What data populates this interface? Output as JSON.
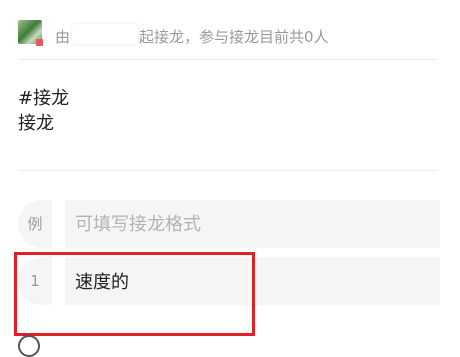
{
  "header": {
    "prefix": "由",
    "suffix": "起接龙，参与接龙目前共0人"
  },
  "post": {
    "title_line1": "#接龙",
    "title_line2": "接龙"
  },
  "example_row": {
    "index_label": "例",
    "placeholder": "可填写接龙格式"
  },
  "entry_row": {
    "index_label": "1",
    "value": "速度的"
  },
  "colors": {
    "highlight": "#e01f26",
    "field_background": "#f5f5f5",
    "muted_text": "#9a9a9a"
  }
}
